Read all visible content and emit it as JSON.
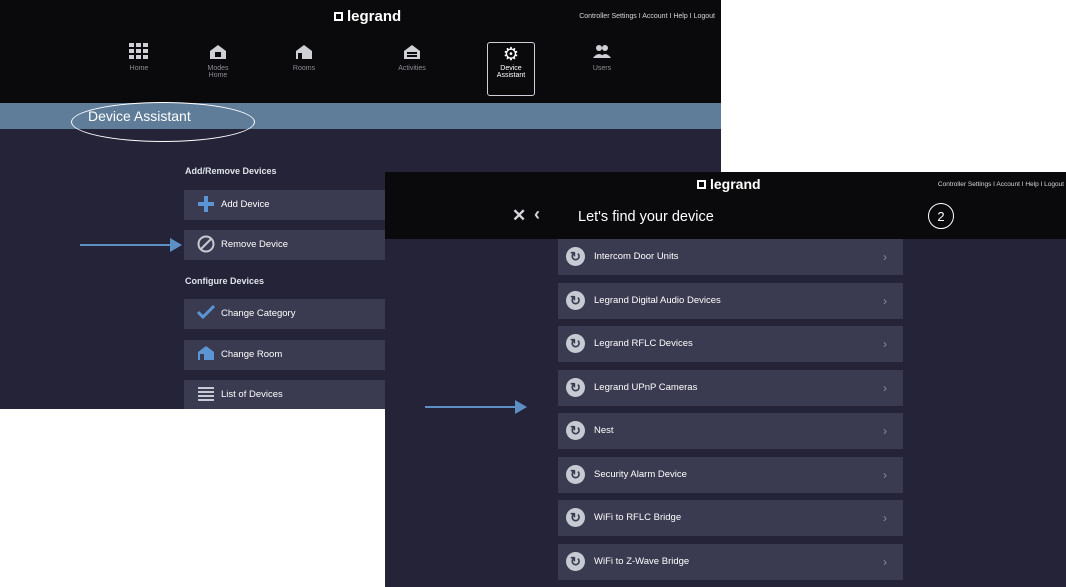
{
  "brand": "legrand",
  "top_links": "Controller Settings I Account I Help I Logout",
  "nav": [
    {
      "label": "Home",
      "icon": "grid-icon"
    },
    {
      "label": "Modes\nHome",
      "icon": "modes-icon"
    },
    {
      "label": "Rooms",
      "icon": "house-icon"
    },
    {
      "label": "Activities",
      "icon": "activities-icon"
    },
    {
      "label": "Device\nAssistant",
      "icon": "gear-icon",
      "active": true
    },
    {
      "label": "Users",
      "icon": "users-icon"
    }
  ],
  "screen1": {
    "title": "Device Assistant",
    "section_add_remove": "Add/Remove Devices",
    "add_device": "Add Device",
    "remove_device": "Remove Device",
    "section_configure": "Configure Devices",
    "change_category": "Change Category",
    "change_room": "Change Room",
    "list_of_devices": "List of Devices"
  },
  "screen2": {
    "header_title": "Let's find your device",
    "step": "2",
    "items": [
      "Intercom Door Units",
      "Legrand Digital Audio Devices",
      "Legrand RFLC Devices",
      "Legrand UPnP Cameras",
      "Nest",
      "Security Alarm Device",
      "WiFi to RFLC Bridge",
      "WiFi to Z-Wave Bridge"
    ]
  },
  "colors": {
    "screen_bg": "#242338",
    "top_bar": "#0a0a0c",
    "title_bar": "#5f7d99",
    "row_bg": "#3a3a50",
    "arrow": "#5c8fc4"
  }
}
